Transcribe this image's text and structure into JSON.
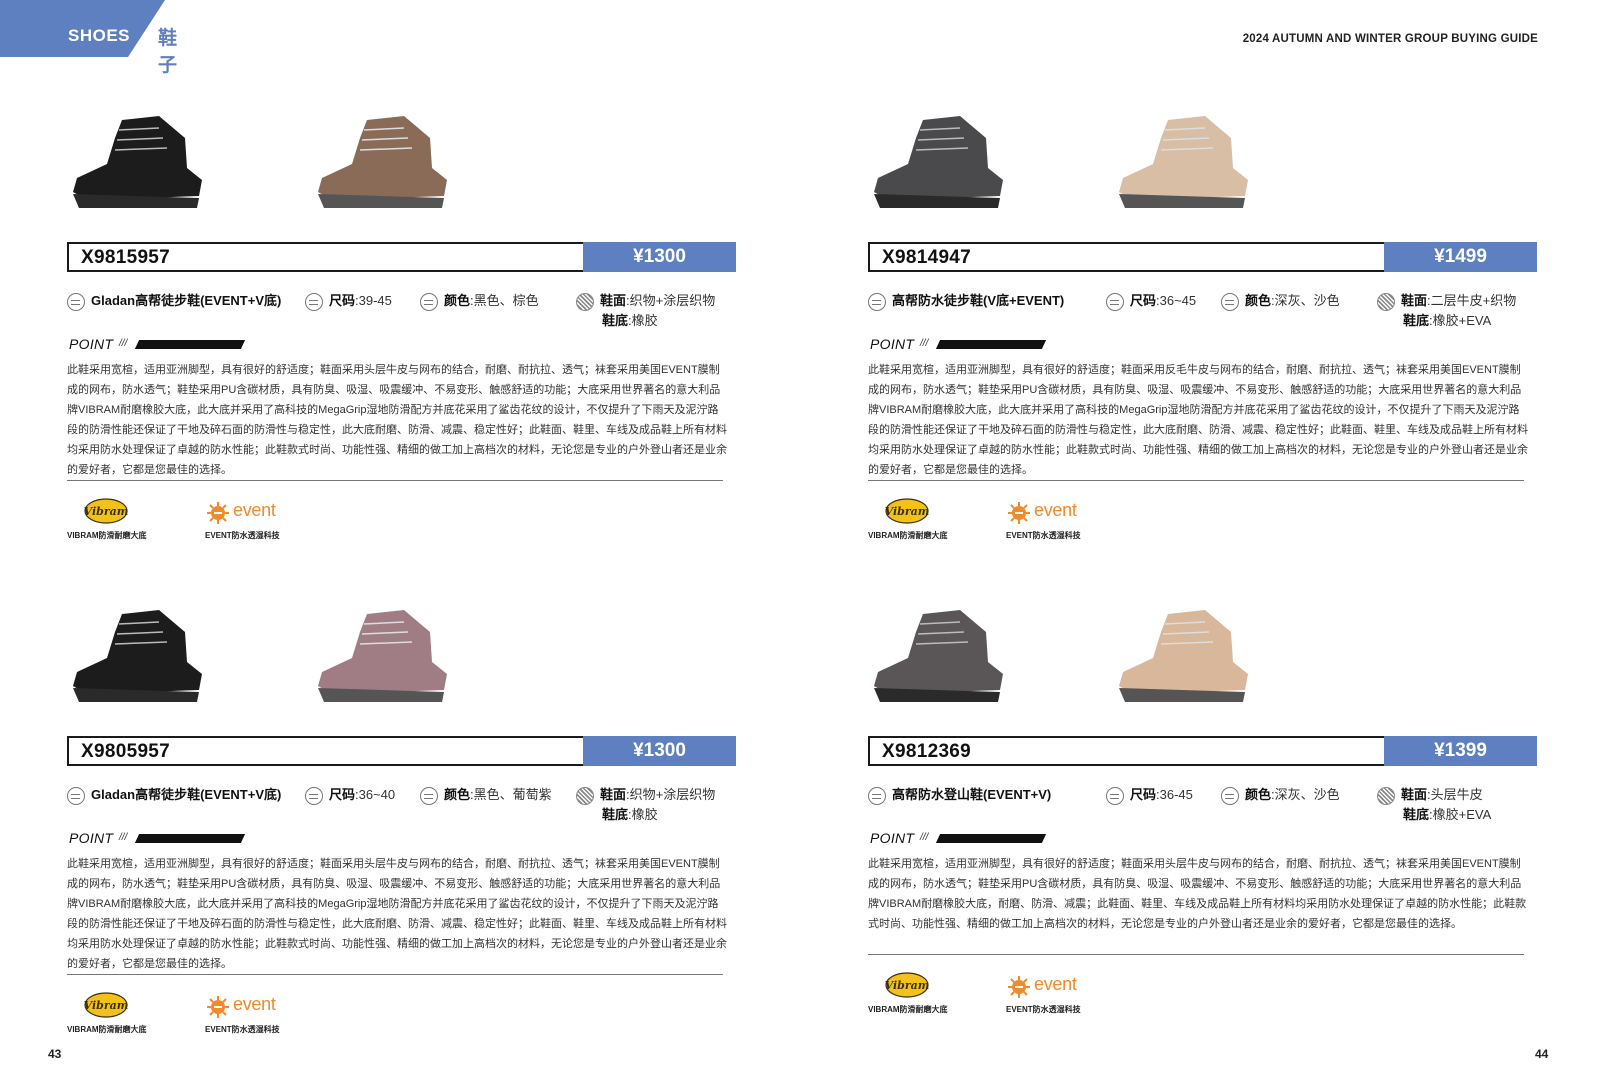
{
  "header": {
    "tab_en": "SHOES",
    "tab_cn": "鞋子",
    "guide_title": "2024 AUTUMN AND WINTER GROUP BUYING GUIDE",
    "accent_color": "#5e7fc0"
  },
  "footer": {
    "left_page": "43",
    "right_page": "44"
  },
  "labels": {
    "point": "POINT",
    "point_slash": "///"
  },
  "products": [
    {
      "code": "X9815957",
      "price": "¥1300",
      "name": "Gladan高帮徒步鞋(EVENT+V底)",
      "size_label": "尺码",
      "size": ":39-45",
      "color_label": "颜色",
      "colors": ":黑色、棕色",
      "upper_label": "鞋面",
      "upper": ":织物+涂层织物",
      "sole_label": "鞋底",
      "sole": ":橡胶",
      "shoe_colors": [
        "#1c1c1c",
        "#8a6b58"
      ],
      "description": "此鞋采用宽楦，适用亚洲脚型，具有很好的舒适度；鞋面采用头层牛皮与网布的结合，耐磨、耐抗拉、透气；袜套采用美国EVENT膜制成的网布，防水透气；鞋垫采用PU含碳材质，具有防臭、吸湿、吸震缓冲、不易变形、触感舒适的功能；大底采用世界著名的意大利品牌VIBRAM耐磨橡胶大底，此大底并采用了高科技的MegaGrip湿地防滑配方并底花采用了鲨齿花纹的设计，不仅提升了下雨天及泥泞路段的防滑性能还保证了干地及碎石面的防滑性与稳定性，此大底耐磨、防滑、减震、稳定性好；此鞋面、鞋里、车线及成品鞋上所有材料均采用防水处理保证了卓越的防水性能；此鞋款式时尚、功能性强、精细的做工加上高档次的材料，无论您是专业的户外登山者还是业余的爱好者，它都是您最佳的选择。",
      "vibram_caption": "VIBRAM防滑耐磨大底",
      "event_caption": "EVENT防水透湿科技",
      "event_word": "event",
      "vibram_word": "Vibram"
    },
    {
      "code": "X9814947",
      "price": "¥1499",
      "name": "高帮防水徒步鞋(V底+EVENT)",
      "size_label": "尺码",
      "size": ":36~45",
      "color_label": "颜色",
      "colors": ":深灰、沙色",
      "upper_label": "鞋面",
      "upper": ":二层牛皮+织物",
      "sole_label": "鞋底",
      "sole": ":橡胶+EVA",
      "shoe_colors": [
        "#4a4a4c",
        "#d9bea6"
      ],
      "description": "此鞋采用宽楦，适用亚洲脚型，具有很好的舒适度；鞋面采用反毛牛皮与网布的结合，耐磨、耐抗拉、透气；袜套采用美国EVENT膜制成的网布，防水透气；鞋垫采用PU含碳材质，具有防臭、吸湿、吸震缓冲、不易变形、触感舒适的功能；大底采用世界著名的意大利品牌VIBRAM耐磨橡胶大底，此大底并采用了高科技的MegaGrip湿地防滑配方并底花采用了鲨齿花纹的设计，不仅提升了下雨天及泥泞路段的防滑性能还保证了干地及碎石面的防滑性与稳定性，此大底耐磨、防滑、减震、稳定性好；此鞋面、鞋里、车线及成品鞋上所有材料均采用防水处理保证了卓越的防水性能；此鞋款式时尚、功能性强、精细的做工加上高档次的材料，无论您是专业的户外登山者还是业余的爱好者，它都是您最佳的选择。",
      "vibram_caption": "VIBRAM防滑耐磨大底",
      "event_caption": "EVENT防水透湿科技",
      "event_word": "event",
      "vibram_word": "Vibram"
    },
    {
      "code": "X9805957",
      "price": "¥1300",
      "name": "Gladan高帮徒步鞋(EVENT+V底)",
      "size_label": "尺码",
      "size": ":36~40",
      "color_label": "颜色",
      "colors": ":黑色、葡萄紫",
      "upper_label": "鞋面",
      "upper": ":织物+涂层织物",
      "sole_label": "鞋底",
      "sole": ":橡胶",
      "shoe_colors": [
        "#1c1c1c",
        "#a07d85"
      ],
      "description": "此鞋采用宽楦，适用亚洲脚型，具有很好的舒适度；鞋面采用头层牛皮与网布的结合，耐磨、耐抗拉、透气；袜套采用美国EVENT膜制成的网布，防水透气；鞋垫采用PU含碳材质，具有防臭、吸湿、吸震缓冲、不易变形、触感舒适的功能；大底采用世界著名的意大利品牌VIBRAM耐磨橡胶大底，此大底并采用了高科技的MegaGrip湿地防滑配方并底花采用了鲨齿花纹的设计，不仅提升了下雨天及泥泞路段的防滑性能还保证了干地及碎石面的防滑性与稳定性，此大底耐磨、防滑、减震、稳定性好；此鞋面、鞋里、车线及成品鞋上所有材料均采用防水处理保证了卓越的防水性能；此鞋款式时尚、功能性强、精细的做工加上高档次的材料，无论您是专业的户外登山者还是业余的爱好者，它都是您最佳的选择。",
      "vibram_caption": "VIBRAM防滑耐磨大底",
      "event_caption": "EVENT防水透湿科技",
      "event_word": "event",
      "vibram_word": "Vibram"
    },
    {
      "code": "X9812369",
      "price": "¥1399",
      "name": "高帮防水登山鞋(EVENT+V)",
      "size_label": "尺码",
      "size": ":36-45",
      "color_label": "颜色",
      "colors": ":深灰、沙色",
      "upper_label": "鞋面",
      "upper": ":头层牛皮",
      "sole_label": "鞋底",
      "sole": ":橡胶+EVA",
      "shoe_colors": [
        "#5a5658",
        "#d9b79b"
      ],
      "description": "此鞋采用宽楦，适用亚洲脚型，具有很好的舒适度；鞋面采用头层牛皮与网布的结合，耐磨、耐抗拉、透气；袜套采用美国EVENT膜制成的网布，防水透气；鞋垫采用PU含碳材质，具有防臭、吸湿、吸震缓冲、不易变形、触感舒适的功能；大底采用世界著名的意大利品牌VIBRAM耐磨橡胶大底，耐磨、防滑、减震；此鞋面、鞋里、车线及成品鞋上所有材料均采用防水处理保证了卓越的防水性能；此鞋款式时尚、功能性强、精细的做工加上高档次的材料，无论您是专业的户外登山者还是业余的爱好者，它都是您最佳的选择。",
      "vibram_caption": "VIBRAM防滑耐磨大底",
      "event_caption": "EVENT防水透湿科技",
      "event_word": "event",
      "vibram_word": "Vibram"
    }
  ]
}
